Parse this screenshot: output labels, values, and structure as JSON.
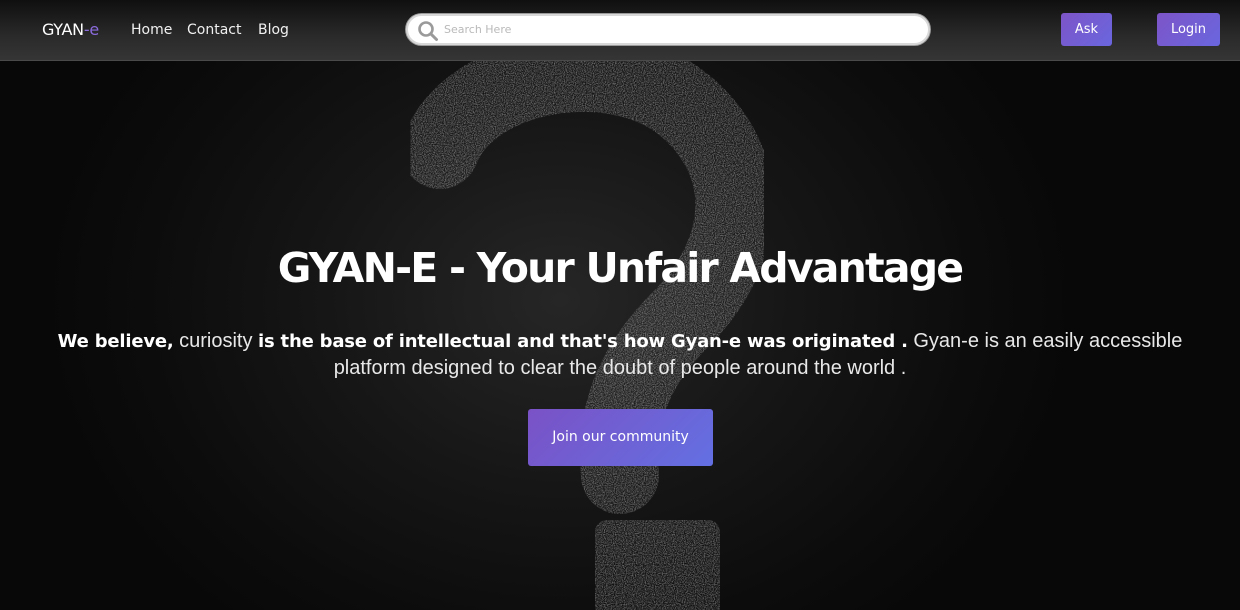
{
  "navbar": {
    "brand_main": "GYAN",
    "brand_accent": "-e",
    "links": [
      "Home",
      "Contact",
      "Blog"
    ],
    "search": {
      "placeholder": "Search Here",
      "value": ""
    },
    "ask_label": "Ask",
    "login_label": "Login"
  },
  "hero": {
    "title": "GYAN-E - Your Unfair Advantage",
    "desc_bold_1": "We believe,",
    "desc_plain_1": " curiosity ",
    "desc_bold_2": "is the base of intellectual and that's how Gyan-e was originated .",
    "desc_plain_2": " Gyan-e is an easily accessible platform designed to clear the doubt of people around the world .",
    "join_label": "Join our community"
  },
  "colors": {
    "accent": "#8a6bdc",
    "button_start": "#7d55c8",
    "button_end": "#6a66de",
    "background": "#0b0b0b"
  },
  "icons": {
    "search": "search-icon",
    "background_mark": "question-mark-icon"
  }
}
